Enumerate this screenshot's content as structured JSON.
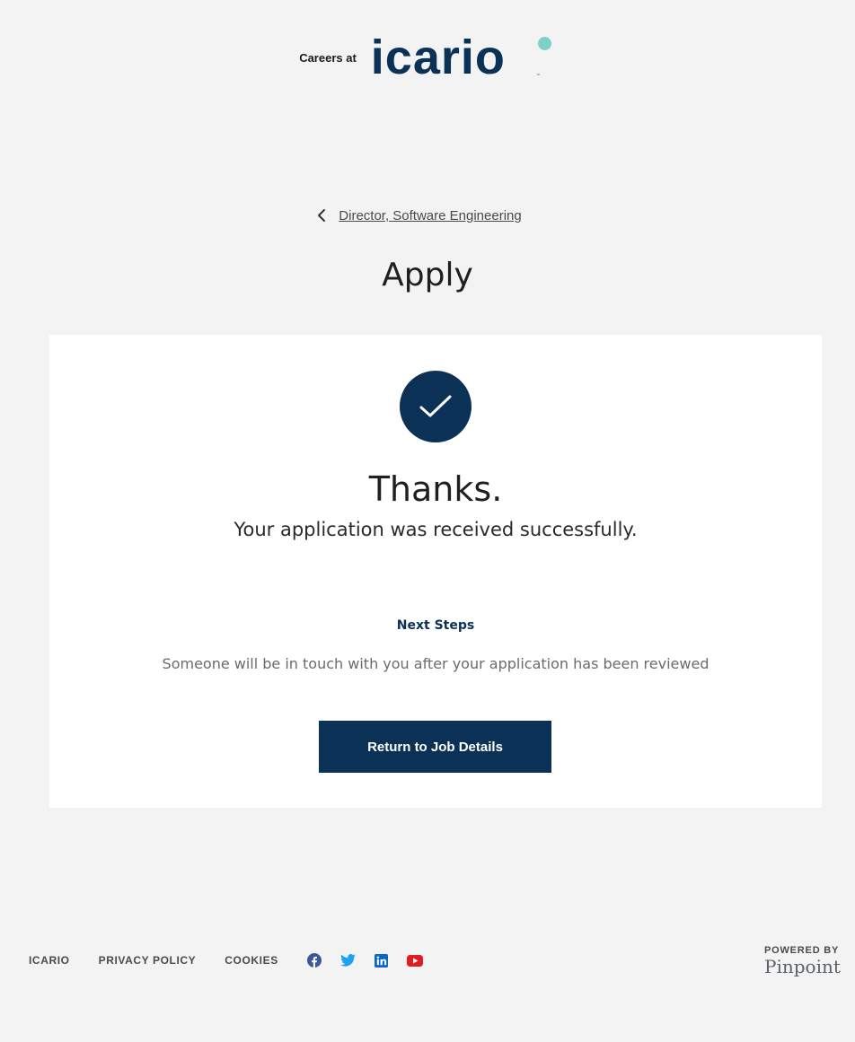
{
  "header": {
    "careers_at": "Careers at",
    "logo_text": "icario",
    "logo_tm": "™"
  },
  "back_link": {
    "label": "Director, Software Engineering",
    "icon": "chevron-left-icon"
  },
  "page_title": "Apply",
  "confirmation": {
    "icon": "checkmark-icon",
    "heading": "Thanks.",
    "message": "Your application was received successfully.",
    "next_steps_title": "Next Steps",
    "next_steps_text": "Someone will be in touch with you after your application has been reviewed",
    "button_label": "Return to Job Details"
  },
  "footer": {
    "links": [
      "ICARIO",
      "PRIVACY POLICY",
      "COOKIES"
    ],
    "social": [
      {
        "name": "facebook-icon",
        "color": "#3b5998"
      },
      {
        "name": "twitter-icon",
        "color": "#1da1f2"
      },
      {
        "name": "linkedin-icon",
        "color": "#0a66c2"
      },
      {
        "name": "youtube-icon",
        "color": "#e31b23"
      }
    ],
    "powered_by": "POWERED BY",
    "powered_brand": "Pinpoint"
  },
  "colors": {
    "brand_navy": "#0b3157",
    "logo_dot": "#7fd0c4",
    "background": "#f3f3f3"
  }
}
